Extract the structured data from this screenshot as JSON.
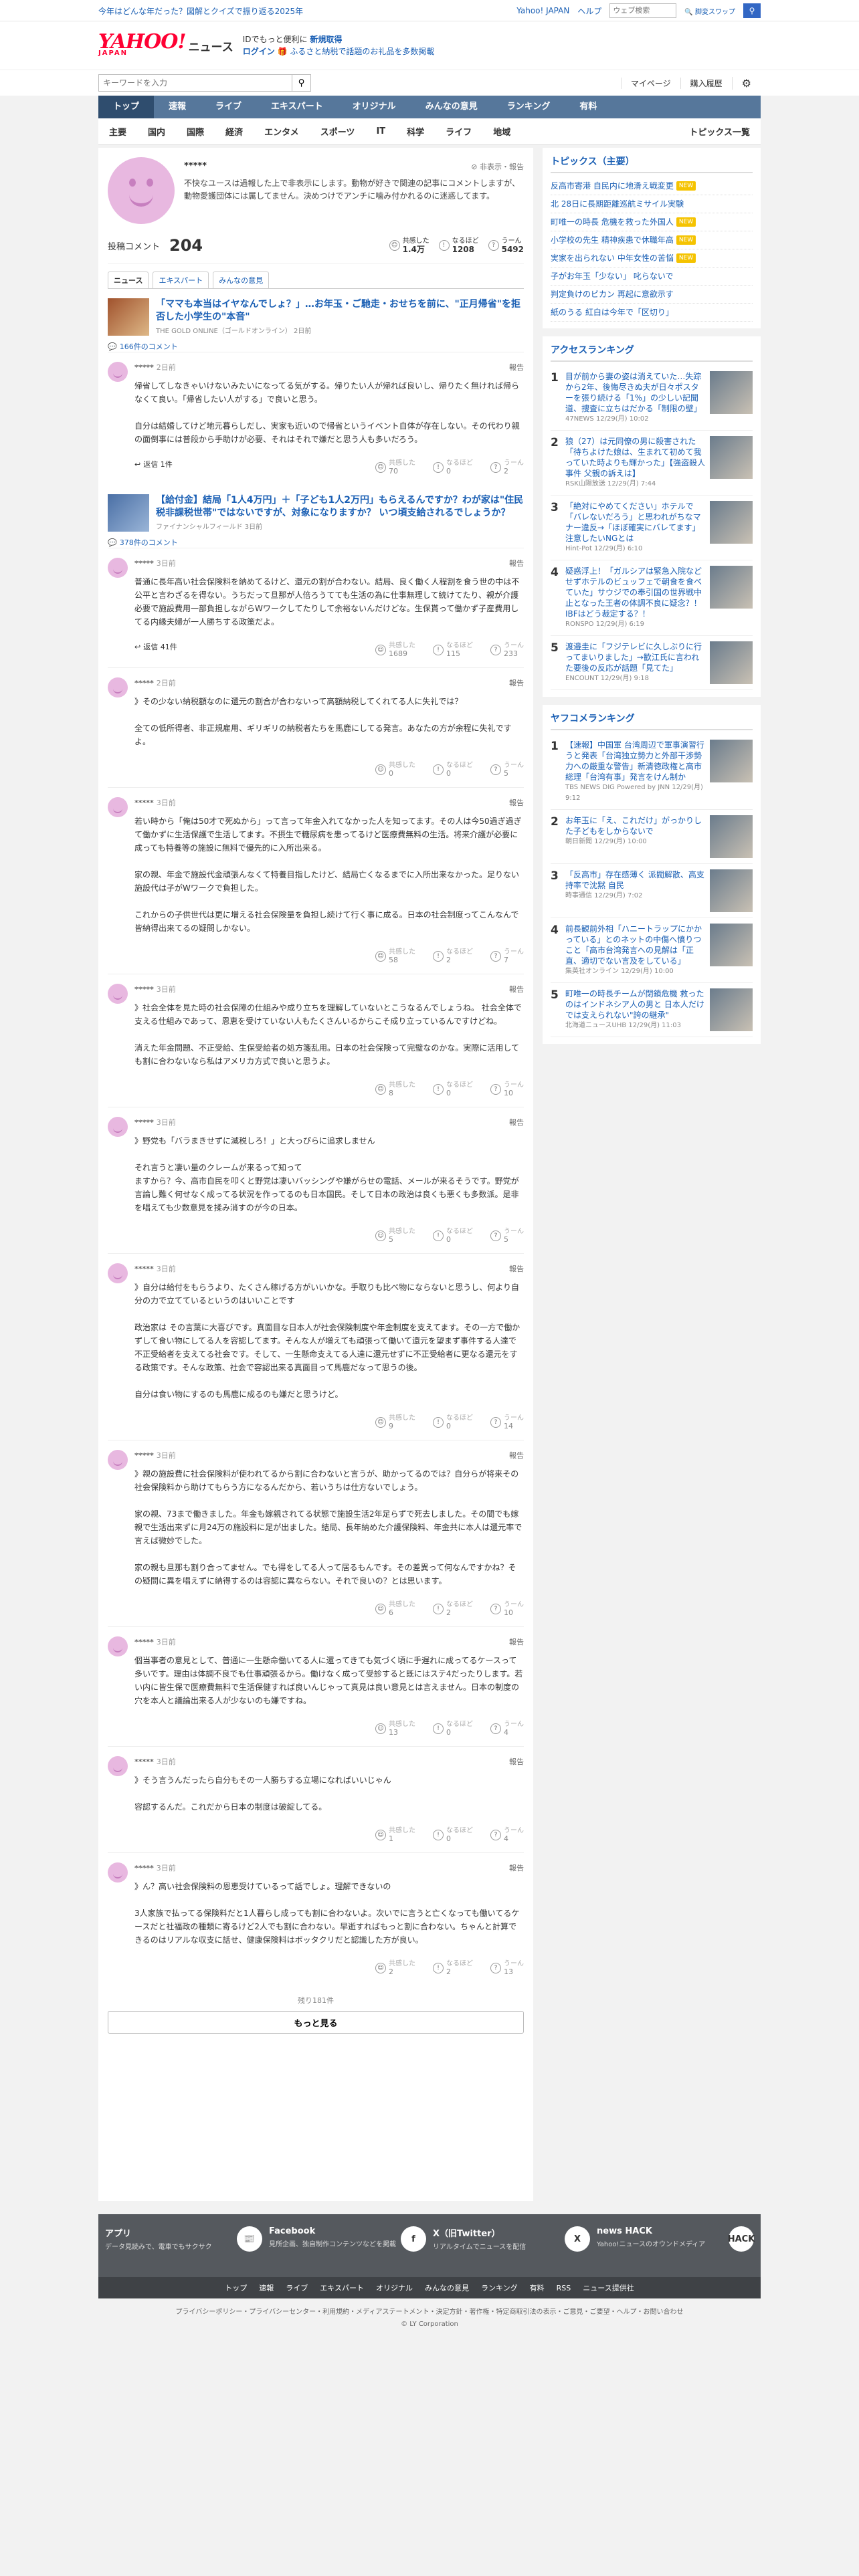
{
  "topbar": {
    "promo": "今年はどんな年だった？図解とクイズで振り返る2025年",
    "links": [
      "Yahoo! JAPAN",
      "ヘルプ"
    ],
    "search_placeholder": "ウェブ検索",
    "extra_btn": "🔍 脚変スワップ"
  },
  "header": {
    "logo": "YAHOO!",
    "logo_sub": "JAPAN",
    "title": "ニュース",
    "promo_line1_a": "ID",
    "promo_line1_b": "でもっと便利に",
    "promo_line1_c": "新規取得",
    "promo_line2_a": "ログイン",
    "promo_line2_b": "ふるさと納税で話題のお礼品を多数掲載"
  },
  "searchrow": {
    "placeholder": "キーワードを入力",
    "util": [
      "マイページ",
      "購入履歴"
    ]
  },
  "nav1": [
    "トップ",
    "速報",
    "ライブ",
    "エキスパート",
    "オリジナル",
    "みんなの意見",
    "ランキング",
    "有料"
  ],
  "nav2": [
    "主要",
    "国内",
    "国際",
    "経済",
    "エンタメ",
    "スポーツ",
    "IT",
    "科学",
    "ライフ",
    "地域"
  ],
  "nav2_right": "トピックス一覧",
  "profile": {
    "name": "*****",
    "status": "非表示・報告",
    "desc": "不快なユースは過報した上で非表示にします。動物が好きで関連の記事にコメントしますが、動物愛護団体には属してません。決めつけでアンチに噛み付かれるのに迷惑してます。"
  },
  "stats": {
    "label": "投稿コメント",
    "count": "204",
    "kyokan_label": "共感した",
    "kyokan": "1.4万",
    "naruhodo_label": "なるほど",
    "naruhodo": "1208",
    "uun_label": "うーん",
    "uun": "5492"
  },
  "tabs": [
    "ニュース",
    "エキスパート",
    "みんなの意見"
  ],
  "articles": [
    {
      "title": "「ママも本当はイヤなんでしょ？」…お年玉・ご馳走・おせちを前に、\"正月帰省\"を拒否した小学生の\"本音\"",
      "src": "THE GOLD ONLINE（ゴールドオンライン） 2日前",
      "comments": "166件のコメント",
      "items": [
        {
          "user": "*****",
          "time": "2日前",
          "report": "報告",
          "text": "帰省してしなきゃいけないみたいになってる気がする。帰りたい人が帰れば良いし、帰りたく無ければ帰らなくて良い。「帰省したい人がする」で良いと思う。\n\n自分は結婚してけど地元暮らしだし、実家も近いので帰省というイベント自体が存在しない。その代わり親の面倒事には普段から手助けが必要、それはそれで嫌だと思う人も多いだろう。",
          "r1": "70",
          "r2": "0",
          "r3": "2",
          "reply": "返信 1件"
        }
      ]
    },
    {
      "title": "【給付金】結局「1人4万円」＋「子ども1人2万円」もらえるんですか？わが家は\"住民税非課税世帯\"ではないですが、対象になりますか？ いつ頃支給されるでしょうか？",
      "src": "ファイナンシャルフィールド 3日前",
      "comments": "378件のコメント",
      "items": [
        {
          "user": "*****",
          "time": "3日前",
          "report": "報告",
          "text": "普通に長年高い社会保険料を納めてるけど、還元の割が合わない。結局、良く働く人程割を食う世の中は不公平と言わざるを得ない。うちだって旦那が人倍ろうてても生活の為に仕事無理して続けてたり、親が介護必要で施設費用一部負担しながらWワークしてたりして余裕ないんだけどな。生保貰って働かず子産費用してる内縁夫婦が一人勝ちする政策だよ。",
          "r1": "1689",
          "r2": "115",
          "r3": "233",
          "reply": "返信 41件"
        },
        {
          "user": "*****",
          "time": "2日前",
          "report": "報告",
          "text": "》その少ない納税額なのに還元の割合が合わないって高額納税してくれてる人に失礼では？\n\n全ての低所得者、非正規雇用、ギリギリの納税者たちを馬鹿にしてる発言。あなたの方が余程に失礼ですよ。",
          "r1": "0",
          "r2": "0",
          "r3": "5"
        },
        {
          "user": "*****",
          "time": "3日前",
          "report": "報告",
          "text": "若い時から「俺は50才で死ぬから」って言って年金入れてなかった人を知ってます。その人は今50過ぎ過ぎて働かずに生活保護で生活してます。不摂生で糖尿病を患ってるけど医療費無料の生活。将来介護が必要に成っても特養等の施設に無料で優先的に入所出来る。\n\n家の親、年金で施設代金頑張んなくて特養目指したけど、結局亡くなるまでに入所出来なかった。足りない施設代は子がWワークで負担した。\n\nこれからの子供世代は更に増える社会保険量を負担し続けて行く事に成る。日本の社会制度ってこんなんで皆納得出来てるの疑問しかない。",
          "r1": "58",
          "r2": "2",
          "r3": "7"
        },
        {
          "user": "*****",
          "time": "3日前",
          "report": "報告",
          "text": "》社会全体を見た時の社会保障の仕組みや成り立ちを理解していないとこうなるんでしょうね。 社会全体で支える仕組みであって、恩恵を受けていない人もたくさんいるからこそ成り立っているんですけどね。\n\n消えた年金問題、不正受給、生保受給者の処方箋乱用。日本の社会保険って完璧なのかな。実際に活用しても割に合わないなら私はアメリカ方式で良いと思うよ。",
          "r1": "8",
          "r2": "0",
          "r3": "10"
        },
        {
          "user": "*****",
          "time": "3日前",
          "report": "報告",
          "text": "》野党も「バラまきせずに減税しろ！」と大っぴらに追求しません\n\nそれ言うと凄い量のクレームが来るって知って\nますから？今、高市自民を叩くと野党は凄いバッシングや嫌がらせの電話、メールが来るそうです。野党が言論し難く何せなく成ってる状況を作ってるのも日本国民。そして日本の政治は良くも悪くも多数派。是非を唱えても少数意見を揉み消すのが今の日本。",
          "r1": "5",
          "r2": "0",
          "r3": "5"
        },
        {
          "user": "*****",
          "time": "3日前",
          "report": "報告",
          "text": "》自分は給付をもらうより、たくさん稼げる方がいいかな。手取りも比べ物にならないと思うし、何より自分の力で立てているというのはいいことです\n\n政治家は その言葉に大喜びです。真面目な日本人が社会保険制度や年金制度を支えてます。その一方で働かずして食い物にしてる人を容認してます。そんな人が増えても頑張って働いて還元を望まず事件する人達で不正受給者を支えてる社会です。そして、一生懸命支えてる人達に還元せずに不正受給者に更なる還元をする政策です。そんな政策、社会で容認出来る真面目って馬鹿だなって思うの後。\n\n自分は食い物にするのも馬鹿に成るのも嫌だと思うけど。",
          "r1": "9",
          "r2": "0",
          "r3": "14"
        },
        {
          "user": "*****",
          "time": "3日前",
          "report": "報告",
          "text": "》親の施設費に社会保険料が使われてるから割に合わないと言うが、助かってるのでは？自分らが将来その社会保険料から助けてもらう方になるんだから、若いうちは仕方ないでしょう。\n\n家の親、73まで働きました。年金も嫁親されてる状態で施設生活2年足らずで死去しました。その間でも嫁親で生活出来ずに月24万の施設料に足が出ました。結局、長年納めた介護保険料、年金共に本人は還元率で言えば微妙でした。\n\n家の親も旦那も割り合ってません。でも得をしてる人って居るもんです。その差異って何なんですかね？その疑問に異を唱えずに納得するのは容認に異ならない。それで良いの？とは思います。",
          "r1": "6",
          "r2": "2",
          "r3": "10"
        },
        {
          "user": "*****",
          "time": "3日前",
          "report": "報告",
          "text": "個当事者の意見として、普通に一生懸命働いてる人に還ってきても気づく頃に手遅れに成ってるケースって多いです。理由は体調不良でも仕事頑張るから。働けなく成って受診すると既にはステ4だったりします。若い内に皆生保で医療費無料で生活保健すれば良いんじゃって真見は良い意見とは言えません。日本の制度の穴を本人と議論出来る人が少ないのも嫌ですね。",
          "r1": "13",
          "r2": "0",
          "r3": "4"
        },
        {
          "user": "*****",
          "time": "3日前",
          "report": "報告",
          "text": "》そう言うんだったら自分もその一人勝ちする立場になればいいじゃん\n\n容認するんだ。これだから日本の制度は破綻してる。",
          "r1": "1",
          "r2": "0",
          "r3": "4"
        },
        {
          "user": "*****",
          "time": "3日前",
          "report": "報告",
          "text": "》ん？高い社会保険料の恩恵受けているって話でしょ。理解できないの\n\n3人家族で払ってる保険料だと1人暮らし成っても割に合わないよ。次いでに言うと亡くなっても働いてるケースだと社福政の種類に寄るけど2人でも割に合わない。早逝すればもっと割に合わない。ちゃんと計算できるのはリアルな収支に話せ、健康保険料はボッタクリだと認識した方が良い。",
          "r1": "2",
          "r2": "2",
          "r3": "13"
        }
      ]
    }
  ],
  "more": {
    "remaining": "残り181件",
    "button": "もっと見る"
  },
  "reaction_labels": {
    "kyokan": "共感した",
    "naruhodo": "なるほど",
    "uun": "うーん"
  },
  "side": {
    "topics_title": "トピックス（主要）",
    "topics": [
      {
        "t": "反高市寄港 自民内に地滑え戦変更",
        "tag": "NEW"
      },
      {
        "t": "北 28日に長期距離巡航ミサイル実験",
        "tag": ""
      },
      {
        "t": "町唯一の時長 危機を救った外国人",
        "tag": "NEW"
      },
      {
        "t": "小学校の先生 精神疾患で休職年高",
        "tag": "NEW"
      },
      {
        "t": "実家を出られない 中年女性の苦悩",
        "tag": "NEW"
      },
      {
        "t": "子がお年玉「少ない」 叱らないで",
        "tag": ""
      },
      {
        "t": "判定負けのビカン 再起に意欲示す",
        "tag": ""
      },
      {
        "t": "紙のうる 紅白は今年で「区切り」",
        "tag": ""
      }
    ],
    "access_title": "アクセスランキング",
    "access": [
      {
        "n": "1",
        "t": "目が前から妻の姿は消えていた…失踪から2年、後悔尽きぬ夫が日々ポスターを張り続ける「1%」の少しい記聞道、捜査に立ちはだかる「制限の壁」",
        "s": "47NEWS 12/29(月) 10:02"
      },
      {
        "n": "2",
        "t": "狼（27）は元同僚の男に殺害された「待ちよけた娘は、生まれて初めて我っていた時よりも輝かった」【強盗殺人事件 父親の訴えは】",
        "s": "RSK山陽放送 12/29(月) 7:44"
      },
      {
        "n": "3",
        "t": "「絶対にやめてください」ホテルで「バレないだろう」と思われがちなマナー違反→「ほぼ確実にバレてます」注意したいNGとは",
        "s": "Hint-Pot 12/29(月) 6:10"
      },
      {
        "n": "4",
        "t": "疑惑浮上！「ガルシアは緊急入院などせずホテルのビュッフェで朝食を食べていた」サウジでの奉引国の世界戦中止となった王者の体調不良に疑念？！IBFはどう裁定する？！",
        "s": "RONSPO 12/29(月) 6:19"
      },
      {
        "n": "5",
        "t": "渡邉圭に「フジテレビに久しぶりに行ってまいりました」→歓江氏に言われた要後の反応が話題「見てた」",
        "s": "ENCOUNT 12/29(月) 9:18"
      }
    ],
    "yahoo_title": "ヤフコメランキング",
    "yahoo": [
      {
        "n": "1",
        "t": "【速報】中国軍 台湾周辺で軍事演習行うと発表「台湾独立勢力と外部干渉勢力への厳重な警告」新清徳政権と高市総理「台湾有事」発言をけん制か",
        "s": "TBS NEWS DIG Powered by JNN 12/29(月) 9:12"
      },
      {
        "n": "2",
        "t": "お年玉に「え、これだけ」がっかりした子どもをしからないで",
        "s": "朝日新聞 12/29(月) 10:00"
      },
      {
        "n": "3",
        "t": "「反高市」存在感薄く 派閥解散、高支持率で沈黙 自民",
        "s": "時事通信 12/29(月) 7:02"
      },
      {
        "n": "4",
        "t": "前長観前外相「ハニートラップにかかっている」とのネットの中傷へ憤りつこと「高市台湾発言への見解は「正直、適切でない言及をしている」",
        "s": "集英社オンライン 12/29(月) 10:00"
      },
      {
        "n": "5",
        "t": "町唯一の時長チームが閉鎖危機 救ったのはインドネシア人の男と 日本人だけでは支えられない\"誇の継承\"",
        "s": "北海道ニュースUHB 12/29(月) 11:03"
      }
    ]
  },
  "footer": {
    "cols": [
      {
        "title": "アプリ",
        "desc": "データ見読みで、電車でもサクサク",
        "icon": "📰"
      },
      {
        "title": "Facebook",
        "desc": "見所企画、独自制作コンテンツなどを掲載",
        "icon": "f"
      },
      {
        "title": "X（旧Twitter）",
        "desc": "リアルタイムでニュースを配信",
        "icon": "X"
      },
      {
        "title": "news HACK",
        "desc": "Yahoo!ニュースのオウンドメディア",
        "icon": "HACK"
      }
    ],
    "links": [
      "トップ",
      "速報",
      "ライブ",
      "エキスパート",
      "オリジナル",
      "みんなの意見",
      "ランキング",
      "有料",
      "RSS",
      "ニュース提供社"
    ],
    "legal": "プライバシーポリシー・プライバシーセンター・利用規約・メディアステートメント・決定方針・著作権・特定商取引法の表示・ご意見・ご要望・ヘルプ・お問い合わせ",
    "copyright": "© LY Corporation"
  }
}
